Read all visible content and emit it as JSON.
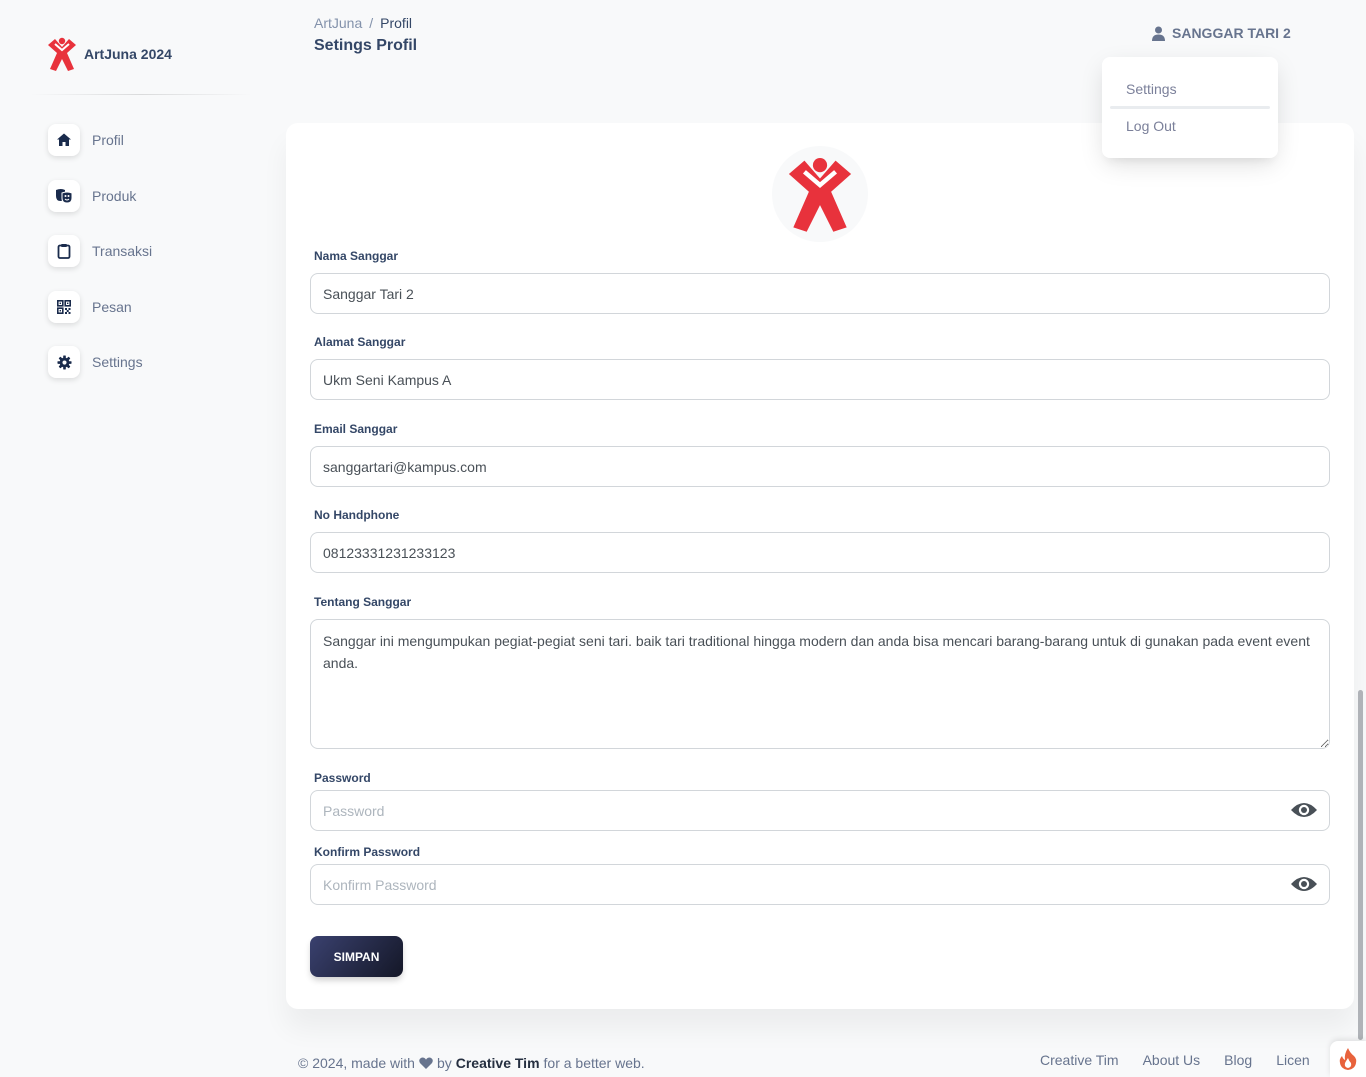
{
  "brand": {
    "name": "ArtJuna 2024"
  },
  "sidebar": {
    "items": [
      {
        "label": "Profil",
        "icon": "home-icon"
      },
      {
        "label": "Produk",
        "icon": "masks-icon"
      },
      {
        "label": "Transaksi",
        "icon": "clipboard-icon"
      },
      {
        "label": "Pesan",
        "icon": "qrcode-icon"
      },
      {
        "label": "Settings",
        "icon": "gear-icon"
      }
    ]
  },
  "header": {
    "breadcrumb_root": "ArtJuna",
    "breadcrumb_sep": "/",
    "breadcrumb_current": "Profil",
    "title": "Setings Profil",
    "user_name": "SANGGAR TARI 2"
  },
  "dropdown": {
    "settings": "Settings",
    "logout": "Log Out"
  },
  "form": {
    "nama_label": "Nama Sanggar",
    "nama_value": "Sanggar Tari 2",
    "alamat_label": "Alamat Sanggar",
    "alamat_value": "Ukm Seni Kampus A",
    "email_label": "Email Sanggar",
    "email_value": "sanggartari@kampus.com",
    "hp_label": "No Handphone",
    "hp_value": "08123331231233123",
    "tentang_label": "Tentang Sanggar",
    "tentang_value": "Sanggar ini mengumpukan pegiat-pegiat seni tari. baik tari traditional hingga modern dan anda bisa mencari barang-barang untuk di gunakan pada event event anda.",
    "password_label": "Password",
    "password_placeholder": "Password",
    "konfirm_label": "Konfirm Password",
    "konfirm_placeholder": "Konfirm Password",
    "save_label": "SIMPAN"
  },
  "footer": {
    "copy_prefix": "© 2024, made with",
    "copy_by": "by",
    "copy_author": "Creative Tim",
    "copy_suffix": "for a better web.",
    "links": [
      "Creative Tim",
      "About Us",
      "Blog",
      "Licen"
    ]
  },
  "colors": {
    "brand_red": "#e8323c",
    "primary_dark": "#344767",
    "button_gradient_start": "#141727",
    "button_gradient_end": "#3a416f"
  }
}
